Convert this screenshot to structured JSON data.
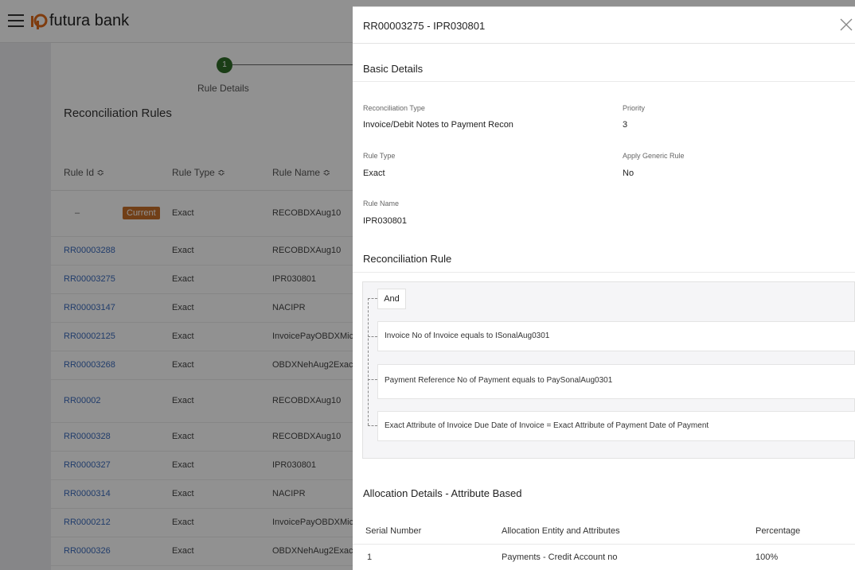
{
  "app": {
    "brand": "futura bank"
  },
  "stepper": {
    "step_number": "1",
    "step_label": "Rule Details"
  },
  "page": {
    "heading": "Reconciliation Rules"
  },
  "rules_table": {
    "columns": [
      "Rule Id ≎",
      "Rule Type ≎",
      "Rule Name ≎"
    ],
    "current_row": {
      "rule_id": "–",
      "badge": "Current",
      "rule_type": "Exact",
      "rule_name": "RECOBDXAug10"
    },
    "rows": [
      {
        "rule_id": "RR00003288",
        "rule_type": "Exact",
        "rule_name": "RECOBDXAug10"
      },
      {
        "rule_id": "RR00003275",
        "rule_type": "Exact",
        "rule_name": "IPR030801"
      },
      {
        "rule_id": "RR00003147",
        "rule_type": "Exact",
        "rule_name": "NACIPR"
      },
      {
        "rule_id": "RR00002125",
        "rule_type": "Exact",
        "rule_name": "InvoicePayOBDXMic"
      },
      {
        "rule_id": "RR00003268",
        "rule_type": "Exact",
        "rule_name": "OBDXNehAug2Exac"
      },
      {
        "rule_id": "RR00002",
        "rule_type": "Exact",
        "rule_name": "RECOBDXAug10"
      },
      {
        "rule_id": "RR0000328",
        "rule_type": "Exact",
        "rule_name": "RECOBDXAug10"
      },
      {
        "rule_id": "RR0000327",
        "rule_type": "Exact",
        "rule_name": "IPR030801"
      },
      {
        "rule_id": "RR0000314",
        "rule_type": "Exact",
        "rule_name": "NACIPR"
      },
      {
        "rule_id": "RR0000212",
        "rule_type": "Exact",
        "rule_name": "InvoicePayOBDXMic"
      },
      {
        "rule_id": "RR0000326",
        "rule_type": "Exact",
        "rule_name": "OBDXNehAug2Exac"
      }
    ]
  },
  "panel": {
    "title": "RR00003275 - IPR030801",
    "basic_details": {
      "title": "Basic Details",
      "recon_type_label": "Reconciliation Type",
      "recon_type_value": "Invoice/Debit Notes to Payment Recon",
      "priority_label": "Priority",
      "priority_value": "3",
      "rule_type_label": "Rule Type",
      "rule_type_value": "Exact",
      "generic_label": "Apply Generic Rule",
      "generic_value": "No",
      "rule_name_label": "Rule Name",
      "rule_name_value": "IPR030801"
    },
    "recon_rule": {
      "title": "Reconciliation Rule",
      "operator": "And",
      "conditions": [
        "Invoice No of Invoice equals to ISonalAug0301",
        "Payment Reference No of Payment equals to PaySonalAug0301",
        "Exact Attribute of Invoice Due Date of Invoice = Exact Attribute of Payment Date of Payment"
      ]
    },
    "allocation": {
      "title": "Allocation Details - Attribute Based",
      "headers": [
        "Serial Number",
        "Allocation Entity and Attributes",
        "Percentage"
      ],
      "rows": [
        {
          "serial": "1",
          "entity": "Payments - Credit Account no",
          "percentage": "100%"
        }
      ]
    }
  },
  "colors": {
    "link": "#3b6bbd",
    "stepper": "#2f6b27",
    "badge": "#c7702a",
    "overlay": "rgba(0,0,0,0.43)"
  }
}
